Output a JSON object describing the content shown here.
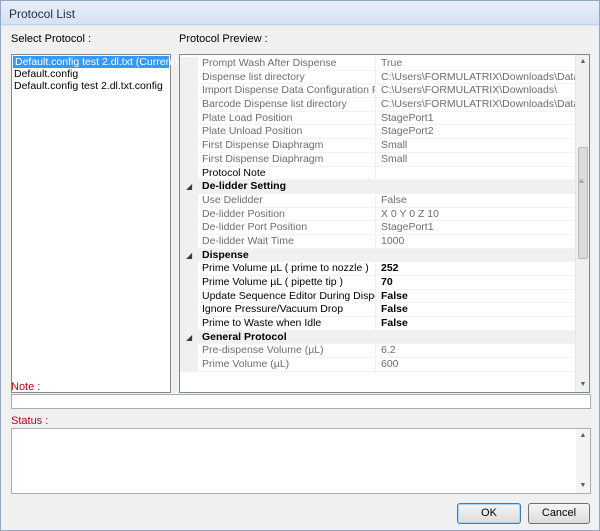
{
  "window": {
    "title": "Protocol List"
  },
  "select_protocol": {
    "label": "Select Protocol :",
    "items": [
      "Default.config test 2.dl.txt (Current)",
      "Default.config",
      "Default.config test 2.dl.txt.config"
    ],
    "selected_index": 0
  },
  "preview": {
    "label": "Protocol Preview :",
    "rows": [
      {
        "type": "prop",
        "name": "Prompt Wash After Dispense",
        "value": "True",
        "active": false
      },
      {
        "type": "prop",
        "name": "Dispense list directory",
        "value": "C:\\Users\\FORMULATRIX\\Downloads\\Data\\Us",
        "active": false
      },
      {
        "type": "prop",
        "name": "Import Dispense Data Configuration File",
        "value": "C:\\Users\\FORMULATRIX\\Downloads\\",
        "active": false
      },
      {
        "type": "prop",
        "name": "Barcode Dispense list directory",
        "value": "C:\\Users\\FORMULATRIX\\Downloads\\Data\\Us",
        "active": false
      },
      {
        "type": "prop",
        "name": "Plate Load Position",
        "value": "StagePort1",
        "active": false
      },
      {
        "type": "prop",
        "name": "Plate Unload Position",
        "value": "StagePort2",
        "active": false
      },
      {
        "type": "prop",
        "name": "First Dispense Diaphragm",
        "value": "Small",
        "active": false
      },
      {
        "type": "prop",
        "name": "First Dispense Diaphragm",
        "value": "Small",
        "active": false
      },
      {
        "type": "prop",
        "name": "Protocol Note",
        "value": "",
        "active": true,
        "bold": false
      },
      {
        "type": "category",
        "name": "De-lidder Setting"
      },
      {
        "type": "prop",
        "name": "Use Delidder",
        "value": "False",
        "active": false
      },
      {
        "type": "prop",
        "name": "De-lidder Position",
        "value": "X 0 Y 0 Z 10",
        "active": false
      },
      {
        "type": "prop",
        "name": "De-lidder Port Position",
        "value": "StagePort1",
        "active": false
      },
      {
        "type": "prop",
        "name": "De-lidder Wait Time",
        "value": "1000",
        "active": false
      },
      {
        "type": "category",
        "name": "Dispense"
      },
      {
        "type": "prop",
        "name": "Prime Volume µL ( prime to nozzle )",
        "value": "252",
        "active": true,
        "bold": true
      },
      {
        "type": "prop",
        "name": "Prime Volume µL ( pipette tip )",
        "value": "70",
        "active": true,
        "bold": true
      },
      {
        "type": "prop",
        "name": "Update Sequence Editor During Dispense",
        "value": "False",
        "active": true,
        "bold": true
      },
      {
        "type": "prop",
        "name": "Ignore Pressure/Vacuum Drop",
        "value": "False",
        "active": true,
        "bold": true
      },
      {
        "type": "prop",
        "name": "Prime to Waste when Idle",
        "value": "False",
        "active": true,
        "bold": true
      },
      {
        "type": "category",
        "name": "General Protocol"
      },
      {
        "type": "prop",
        "name": "Pre-dispense Volume (µL)",
        "value": "6.2",
        "active": false
      },
      {
        "type": "prop",
        "name": "Prime Volume (µL)",
        "value": "600",
        "active": false
      }
    ]
  },
  "note": {
    "label": "Note :",
    "value": ""
  },
  "status": {
    "label": "Status :",
    "value": ""
  },
  "buttons": {
    "ok": "OK",
    "cancel": "Cancel"
  },
  "icons": {
    "collapse": "collapse-triangle-icon",
    "scroll_up": "scroll-up-arrow-icon",
    "scroll_down": "scroll-down-arrow-icon"
  }
}
